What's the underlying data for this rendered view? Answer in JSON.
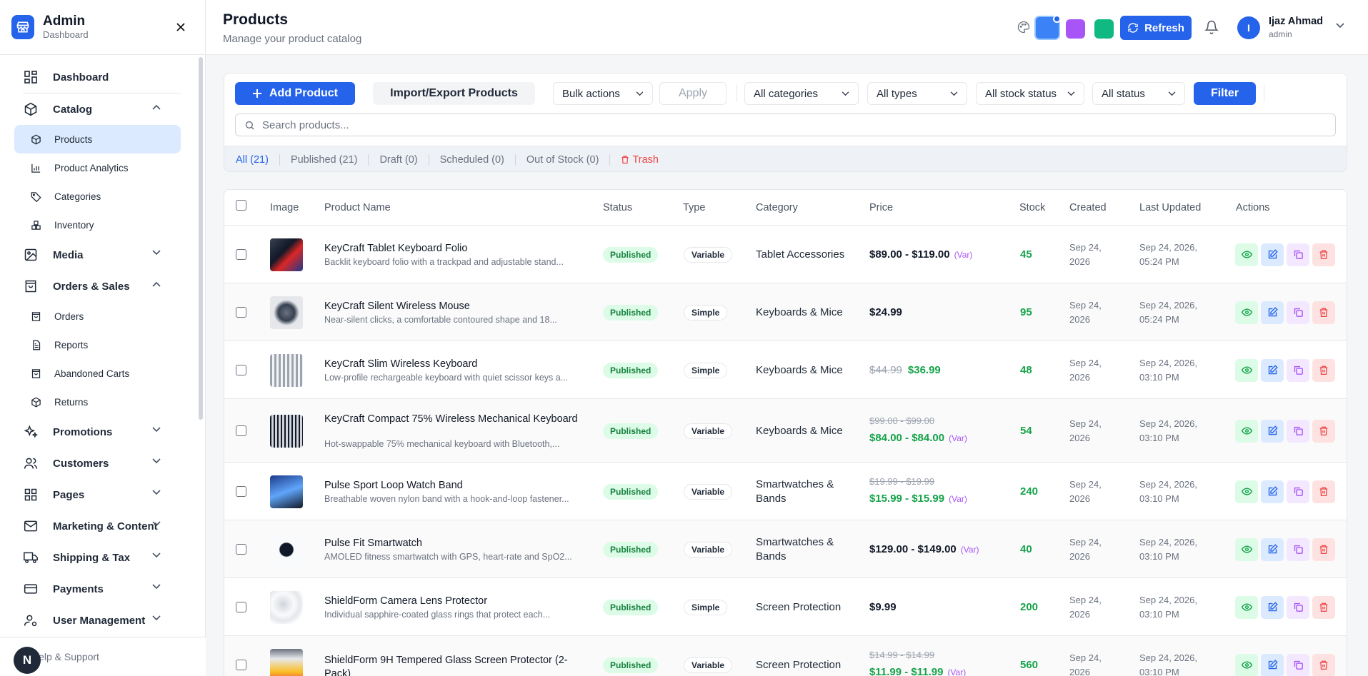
{
  "brand": {
    "title": "Admin",
    "subtitle": "Dashboard"
  },
  "sidebar": {
    "dashboard": "Dashboard",
    "catalog": "Catalog",
    "catalog_items": [
      "Products",
      "Product Analytics",
      "Categories",
      "Inventory"
    ],
    "media": "Media",
    "orders": "Orders & Sales",
    "orders_items": [
      "Orders",
      "Reports",
      "Abandoned Carts",
      "Returns"
    ],
    "promotions": "Promotions",
    "customers": "Customers",
    "pages": "Pages",
    "marketing": "Marketing & Content",
    "shipping": "Shipping & Tax",
    "payments": "Payments",
    "users": "User Management",
    "help": "Help & Support",
    "help_avatar": "N"
  },
  "header": {
    "title": "Products",
    "subtitle": "Manage your product catalog",
    "refresh": "Refresh",
    "user_initial": "I",
    "user_name": "Ijaz Ahmad",
    "user_role": "admin",
    "swatches": [
      "#3b82f6",
      "#a855f7",
      "#10b981"
    ]
  },
  "toolbar": {
    "add": "Add Product",
    "import": "Import/Export Products",
    "bulk": "Bulk actions",
    "apply": "Apply",
    "categories": "All categories",
    "types": "All types",
    "stock": "All stock status",
    "status": "All status",
    "filter": "Filter",
    "search_placeholder": "Search products..."
  },
  "tabs": {
    "all": "All (21)",
    "published": "Published (21)",
    "draft": "Draft (0)",
    "scheduled": "Scheduled (0)",
    "out_of_stock": "Out of Stock (0)",
    "trash": "Trash"
  },
  "table": {
    "headers": {
      "image": "Image",
      "name": "Product Name",
      "status": "Status",
      "type": "Type",
      "category": "Category",
      "price": "Price",
      "stock": "Stock",
      "created": "Created",
      "updated": "Last Updated",
      "actions": "Actions"
    },
    "rows": [
      {
        "name": "KeyCraft Tablet Keyboard Folio",
        "desc": "Backlit keyboard folio with a trackpad and adjustable stand...",
        "status": "Published",
        "type": "Variable",
        "category": "Tablet Accessories",
        "price": "$89.00 - $119.00",
        "var": "(Var)",
        "stock": "45",
        "created": "Sep 24, 2026",
        "updated": "Sep 24, 2026, 05:24 PM"
      },
      {
        "name": "KeyCraft Silent Wireless Mouse",
        "desc": "Near-silent clicks, a comfortable contoured shape and 18...",
        "status": "Published",
        "type": "Simple",
        "category": "Keyboards & Mice",
        "price": "$24.99",
        "stock": "95",
        "created": "Sep 24, 2026",
        "updated": "Sep 24, 2026, 05:24 PM"
      },
      {
        "name": "KeyCraft Slim Wireless Keyboard",
        "desc": "Low-profile rechargeable keyboard with quiet scissor keys a...",
        "status": "Published",
        "type": "Simple",
        "category": "Keyboards & Mice",
        "old_price": "$44.99",
        "sale_price": "$36.99",
        "stock": "48",
        "created": "Sep 24, 2026",
        "updated": "Sep 24, 2026, 03:10 PM"
      },
      {
        "name": "KeyCraft Compact 75% Wireless Mechanical Keyboard",
        "desc": "Hot-swappable 75% mechanical keyboard with Bluetooth,...",
        "status": "Published",
        "type": "Variable",
        "category": "Keyboards & Mice",
        "old_price": "$99.00 - $99.00",
        "sale_price": "$84.00 - $84.00",
        "var": "(Var)",
        "stock": "54",
        "created": "Sep 24, 2026",
        "updated": "Sep 24, 2026, 03:10 PM"
      },
      {
        "name": "Pulse Sport Loop Watch Band",
        "desc": "Breathable woven nylon band with a hook-and-loop fastener...",
        "status": "Published",
        "type": "Variable",
        "category": "Smartwatches & Bands",
        "old_price": "$19.99 - $19.99",
        "sale_price": "$15.99 - $15.99",
        "var": "(Var)",
        "stock": "240",
        "created": "Sep 24, 2026",
        "updated": "Sep 24, 2026, 03:10 PM"
      },
      {
        "name": "Pulse Fit Smartwatch",
        "desc": "AMOLED fitness smartwatch with GPS, heart-rate and SpO2...",
        "status": "Published",
        "type": "Variable",
        "category": "Smartwatches & Bands",
        "price": "$129.00 - $149.00",
        "var": "(Var)",
        "stock": "40",
        "created": "Sep 24, 2026",
        "updated": "Sep 24, 2026, 03:10 PM"
      },
      {
        "name": "ShieldForm Camera Lens Protector",
        "desc": "Individual sapphire-coated glass rings that protect each...",
        "status": "Published",
        "type": "Simple",
        "category": "Screen Protection",
        "price": "$9.99",
        "stock": "200",
        "created": "Sep 24, 2026",
        "updated": "Sep 24, 2026, 03:10 PM"
      },
      {
        "name": "ShieldForm 9H Tempered Glass Screen Protector (2-Pack)",
        "status": "Published",
        "type": "Variable",
        "category": "Screen Protection",
        "old_price": "$14.99 - $14.99",
        "sale_price": "$11.99 - $11.99",
        "var": "(Var)",
        "stock": "560",
        "created": "Sep 24, 2026",
        "updated": "Sep 24, 2026, 03:10 PM"
      }
    ]
  }
}
